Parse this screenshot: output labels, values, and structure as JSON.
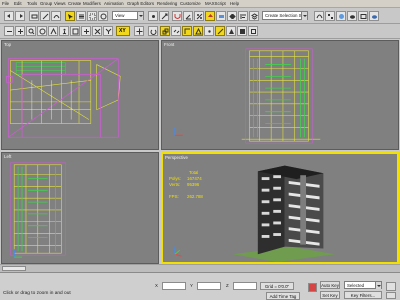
{
  "menubar": {
    "items": [
      "File",
      "Edit",
      "Tools",
      "Group",
      "Views",
      "Create",
      "Modifiers",
      "Animation",
      "Graph Editors",
      "Rendering",
      "Customize",
      "MAXScript",
      "Help"
    ]
  },
  "toolbar": {
    "view_dropdown": "View",
    "selection_set_dropdown": "Create Selection Set"
  },
  "axis_constraint": "XY",
  "viewports": [
    {
      "id": "top",
      "label": "Top",
      "active": false
    },
    {
      "id": "front",
      "label": "Front",
      "active": false
    },
    {
      "id": "left",
      "label": "Left",
      "active": false
    },
    {
      "id": "perspective",
      "label": "Perspective",
      "active": true
    }
  ],
  "stats": {
    "header": "Total",
    "polys_label": "Polys:",
    "polys_value": "167474",
    "verts_label": "Verts:",
    "verts_value": "95396",
    "fps_label": "FPS:",
    "fps_value": "262.788"
  },
  "status": {
    "prompt": "Click or click-and-drag to select objects",
    "hint": "Click or drag to zoom in and out"
  },
  "bottom": {
    "x_label": "X",
    "y_label": "Y",
    "z_label": "Z",
    "grid_label": "Grid = 0'0.0\"",
    "auto_key_label": "Auto Key",
    "set_key_label": "Set Key",
    "selected_dropdown": "Selected",
    "key_filters_label": "Key Filters...",
    "add_time_tag_label": "Add Time Tag"
  },
  "colors": {
    "viewport_bg": "#808080",
    "active_border": "#f3e000",
    "wire_yellow": "#e2e23a",
    "wire_green": "#3fd24a",
    "wire_magenta": "#d15ad9",
    "stats_color": "#f1e000"
  }
}
